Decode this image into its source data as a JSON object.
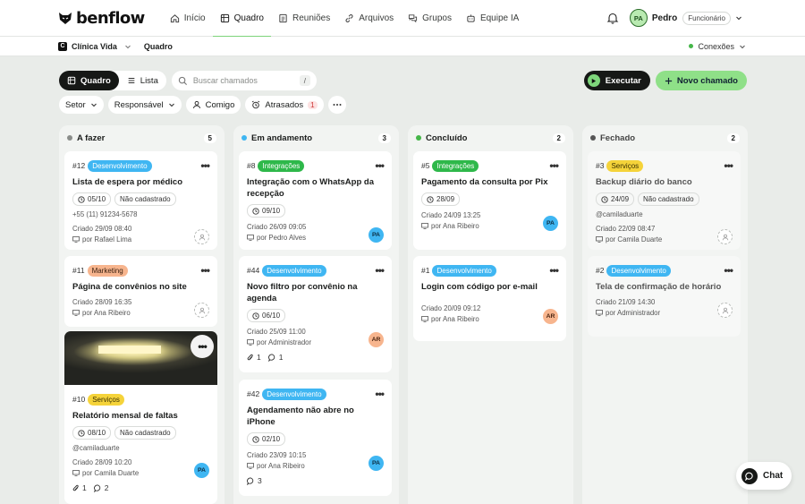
{
  "brand": {
    "name": "benflow"
  },
  "nav": [
    {
      "label": "Início",
      "icon": "home-icon"
    },
    {
      "label": "Quadro",
      "icon": "board-icon",
      "active": true
    },
    {
      "label": "Reuniões",
      "icon": "document-icon"
    },
    {
      "label": "Arquivos",
      "icon": "link-icon"
    },
    {
      "label": "Grupos",
      "icon": "chat-bubbles-icon"
    },
    {
      "label": "Equipe IA",
      "icon": "robot-icon"
    }
  ],
  "user": {
    "initials": "PA",
    "name": "Pedro",
    "role": "Funcionário"
  },
  "workspace": {
    "logo": "C",
    "name": "Clínica Vida",
    "crumb": "Quadro",
    "connections": "Conexões"
  },
  "toolbar": {
    "view_board": "Quadro",
    "view_list": "Lista",
    "search_placeholder": "Buscar chamados",
    "search_key": "/",
    "execute": "Executar",
    "new_ticket": "Novo chamado"
  },
  "filters": {
    "sector": "Setor",
    "owner": "Responsável",
    "mine": "Comigo",
    "late": "Atrasados",
    "late_count": "1"
  },
  "colors": {
    "dev": "#3fb6f2",
    "integ": "#2eb84a",
    "mkt": "#f7b58e",
    "serv": "#f5d33a"
  },
  "columns": [
    {
      "title": "A fazer",
      "count": "5",
      "dot": "#8a8d8a"
    },
    {
      "title": "Em andamento",
      "count": "3",
      "dot": "#3fb6f2"
    },
    {
      "title": "Concluído",
      "count": "2",
      "dot": "#45b649"
    },
    {
      "title": "Fechado",
      "count": "2",
      "dot": "#555555"
    }
  ],
  "cards": {
    "c12": {
      "id": "#12",
      "tag": "Desenvolvimento",
      "title": "Lista de espera por médico",
      "date": "05/10",
      "chip2": "Não cadastrado",
      "phone": "+55 (11) 91234-5678",
      "created": "Criado 29/09 08:40",
      "by": "por Rafael Lima"
    },
    "c11": {
      "id": "#11",
      "tag": "Marketing",
      "title": "Página de convênios no site",
      "created": "Criado 28/09 16:35",
      "by": "por Ana Ribeiro"
    },
    "c10": {
      "id": "#10",
      "tag": "Serviços",
      "title": "Relatório mensal de faltas",
      "date": "08/10",
      "chip2": "Não cadastrado",
      "handle": "@camiladuarte",
      "created": "Criado 28/09 10:20",
      "by": "por Camila Duarte",
      "avatar": "PA",
      "attach": "1",
      "comments": "2"
    },
    "c8": {
      "id": "#8",
      "tag": "Integrações",
      "title": "Integração com o WhatsApp da recepção",
      "date": "09/10",
      "created": "Criado 26/09 09:05",
      "by": "por Pedro Alves",
      "avatar": "PA"
    },
    "c44": {
      "id": "#44",
      "tag": "Desenvolvimento",
      "title": "Novo filtro por convênio na agenda",
      "date": "06/10",
      "created": "Criado 25/09 11:00",
      "by": "por Administrador",
      "avatar": "AR",
      "attach": "1",
      "comments": "1"
    },
    "c42": {
      "id": "#42",
      "tag": "Desenvolvimento",
      "title": "Agendamento não abre no iPhone",
      "date": "02/10",
      "created": "Criado 23/09 10:15",
      "by": "por Ana Ribeiro",
      "avatar": "PA",
      "comments": "3"
    },
    "c5": {
      "id": "#5",
      "tag": "Integrações",
      "title": "Pagamento da consulta por Pix",
      "date": "28/09",
      "created": "Criado 24/09 13:25",
      "by": "por Ana Ribeiro",
      "avatar": "PA"
    },
    "c1": {
      "id": "#1",
      "tag": "Desenvolvimento",
      "title": "Login com código por e-mail",
      "created": "Criado 20/09 09:12",
      "by": "por Ana Ribeiro",
      "avatar": "AR"
    },
    "c3": {
      "id": "#3",
      "tag": "Serviços",
      "title": "Backup diário do banco",
      "date": "24/09",
      "chip2": "Não cadastrado",
      "handle": "@camiladuarte",
      "created": "Criado 22/09 08:47",
      "by": "por Camila Duarte"
    },
    "c2": {
      "id": "#2",
      "tag": "Desenvolvimento",
      "title": "Tela de confirmação de horário",
      "created": "Criado 21/09 14:30",
      "by": "por Administrador"
    }
  },
  "chat": {
    "label": "Chat"
  }
}
